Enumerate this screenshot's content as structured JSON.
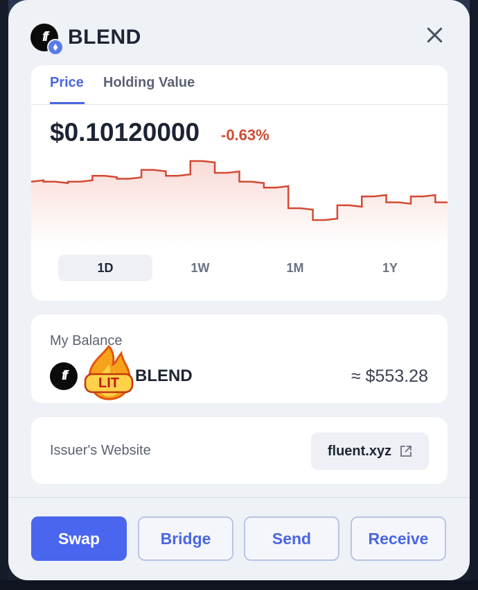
{
  "header": {
    "token_symbol": "BLEND",
    "logo_icon": "fluent-logo-icon",
    "chain_icon": "ethereum-icon"
  },
  "tabs": [
    {
      "label": "Price",
      "active": true
    },
    {
      "label": "Holding Value",
      "active": false
    }
  ],
  "price": {
    "value": "$0.10120000",
    "change": "-0.63%"
  },
  "chart_data": {
    "type": "line",
    "series": [
      {
        "values": [
          0.1012,
          0.1012,
          0.1012,
          0.1014,
          0.1013,
          0.1016,
          0.1014,
          0.1019,
          0.1015,
          0.1012,
          0.101,
          0.1003,
          0.0999,
          0.1004,
          0.1007,
          0.1005,
          0.1007,
          0.1005
        ]
      }
    ],
    "color": "#d24a34"
  },
  "ranges": [
    {
      "label": "1D",
      "active": true
    },
    {
      "label": "1W",
      "active": false
    },
    {
      "label": "1M",
      "active": false
    },
    {
      "label": "1Y",
      "active": false
    }
  ],
  "balance": {
    "label": "My Balance",
    "symbol": "BLEND",
    "value": "≈ $553.28",
    "sticker_text": "LIT"
  },
  "issuer": {
    "label": "Issuer's Website",
    "link_text": "fluent.xyz",
    "link_icon": "external-link-icon"
  },
  "actions": {
    "swap": "Swap",
    "bridge": "Bridge",
    "send": "Send",
    "receive": "Receive"
  },
  "colors": {
    "accent": "#4a66ee",
    "negative": "#d24a34"
  }
}
